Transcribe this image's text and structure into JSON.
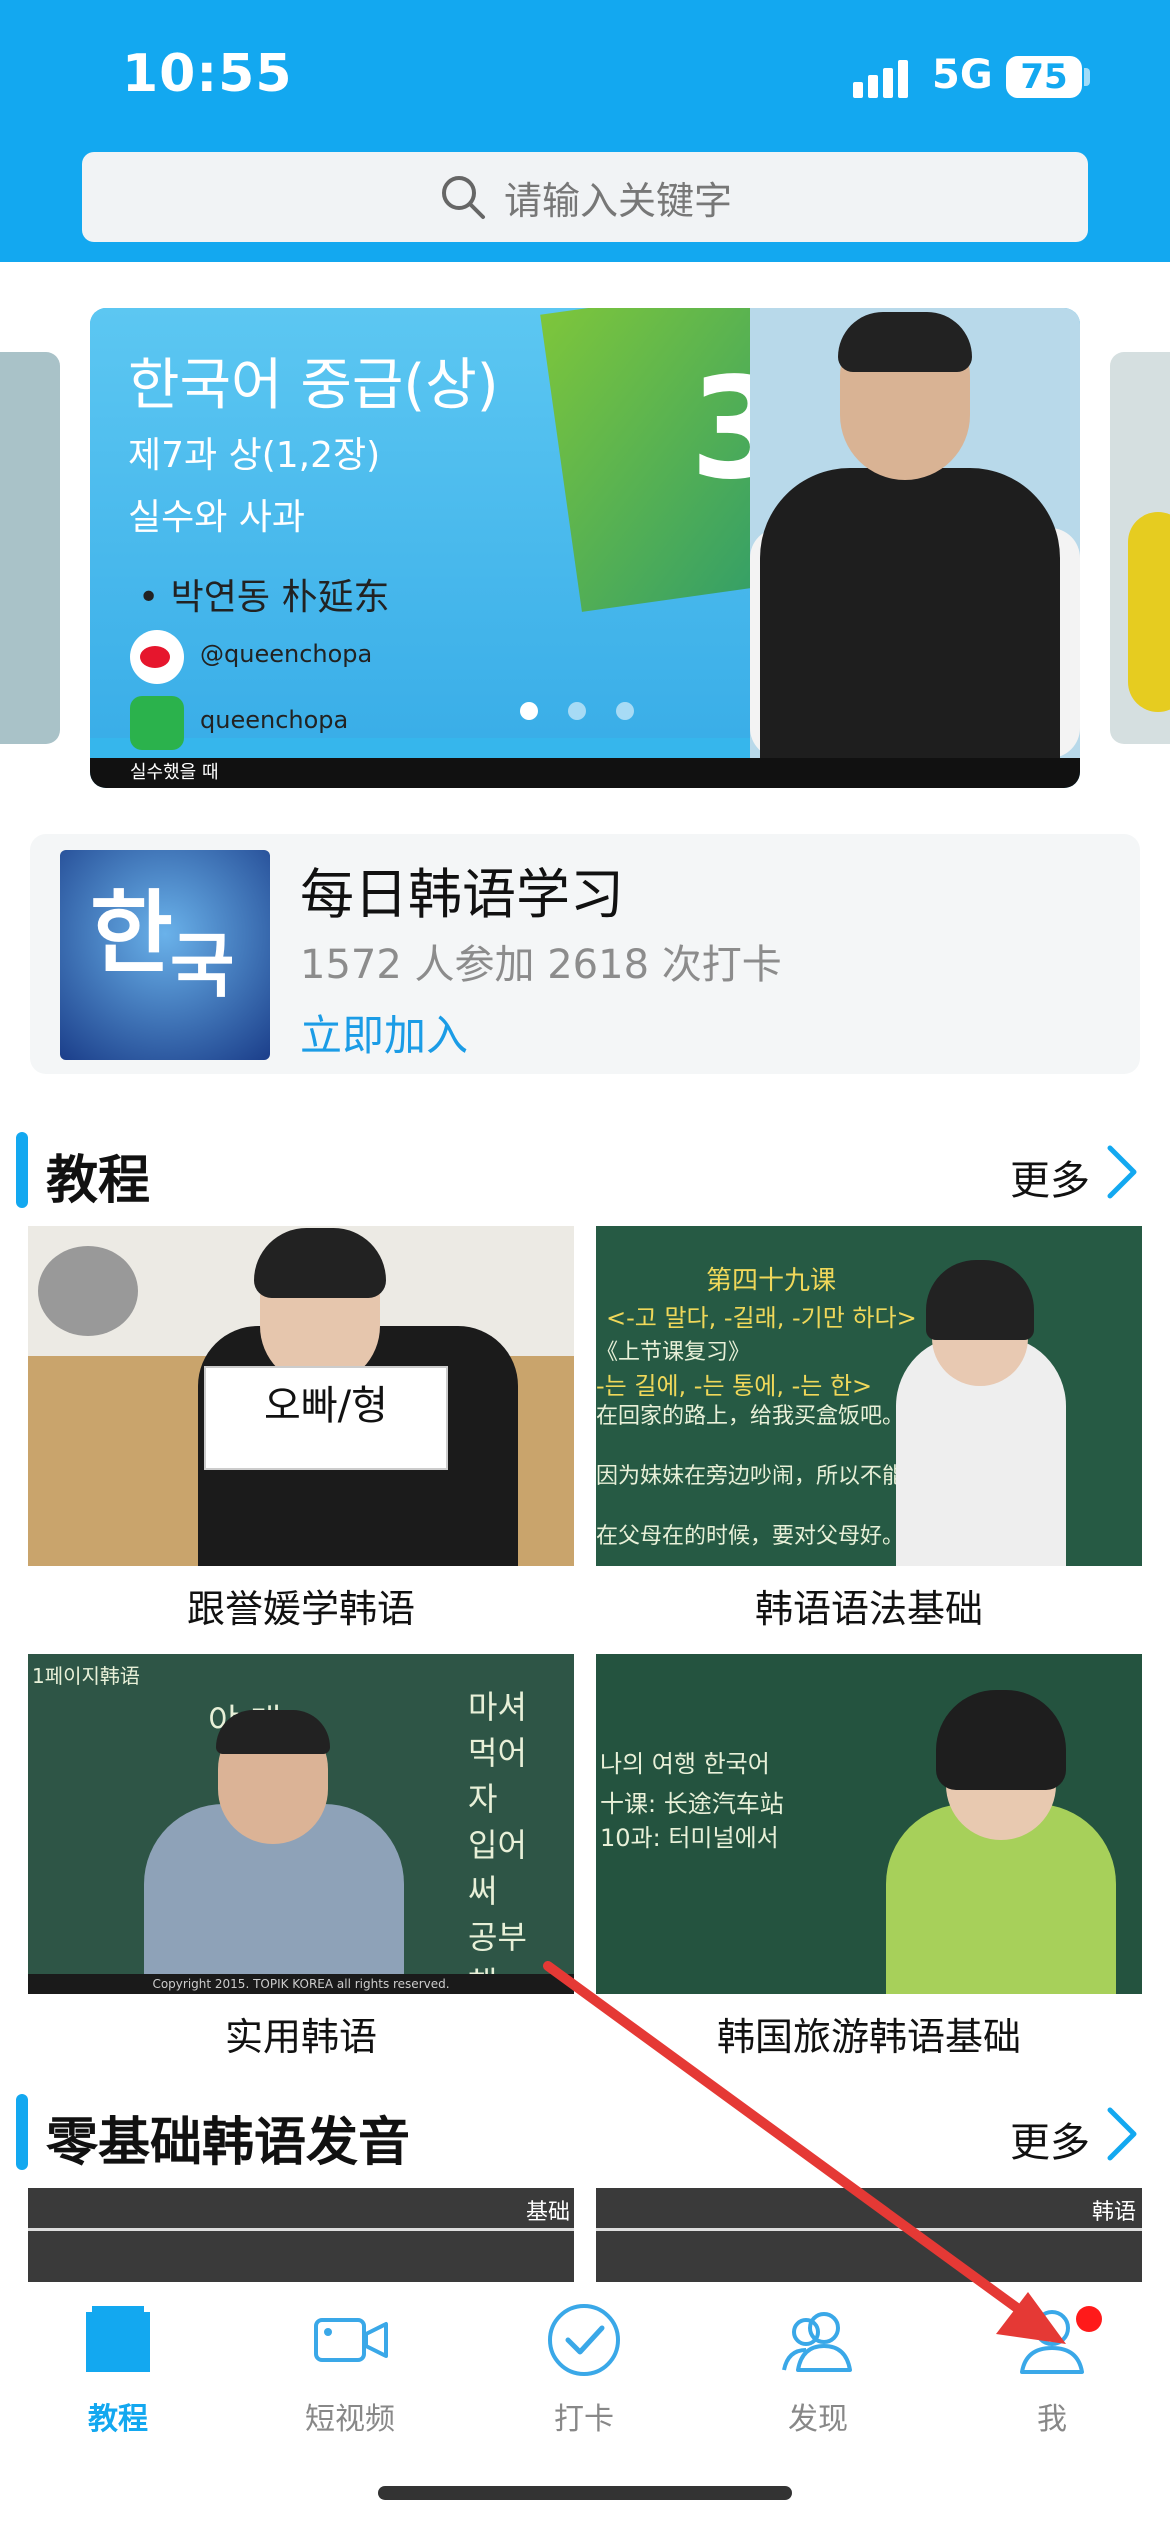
{
  "status": {
    "time": "10:55",
    "network": "5G",
    "battery": "75"
  },
  "search": {
    "placeholder": "请输入关键字",
    "icon": "search-icon"
  },
  "banner": {
    "title": "한국어 중급(상)",
    "line1": "제7과 상(1,2장)",
    "line2": "실수와 사과",
    "teacher": "• 박연동  朴延东",
    "weibo_handle": "@queenchopa",
    "wechat_handle": "queenchopa",
    "subtitle": "실수했을 때",
    "dots": 3,
    "active_dot": 0
  },
  "group": {
    "title": "每日韩语学习",
    "stats": "1572 人参加 2618 次打卡",
    "join": "立即加入"
  },
  "sections": [
    {
      "title": "教程",
      "more": "更多",
      "items": [
        {
          "label": "跟誉媛学韩语"
        },
        {
          "label": "韩语语法基础"
        },
        {
          "label": "实用韩语"
        },
        {
          "label": "韩国旅游韩语基础"
        }
      ]
    },
    {
      "title": "零基础韩语发音",
      "more": "更多"
    }
  ],
  "tiles": {
    "t1_card": "오빠/형",
    "t2_head": "第四十九课",
    "t2_l1": "<-고 말다, -길래, -기만 하다>",
    "t2_l2": "《上节课复习》",
    "t2_l3": "-는 길에, -는 통에, -는 한>",
    "t2_l4": "在回家的路上，给我买盒饭吧。",
    "t2_l5": "因为妹妹在旁边吵闹，所以不能集中。",
    "t2_l6": "在父母在的时候，要对父母好。",
    "t3_head": "1페이지韩语",
    "t3_chalk1": "야 대",
    "t3_chalk2": "마셔 먹어 자 입어 써 공부해",
    "t3_copy": "Copyright 2015. TOPIK KOREA all rights reserved.",
    "t4_l1": "나의 여행 한국어",
    "t4_l2": "十课: 长途汽车站",
    "t4_l3": "10과: 터미널에서",
    "t5_tag": "基础",
    "t6_tag": "韩语"
  },
  "nav": [
    {
      "label": "教程",
      "icon": "book-icon",
      "active": true
    },
    {
      "label": "短视频",
      "icon": "video-camera-icon",
      "active": false
    },
    {
      "label": "打卡",
      "icon": "check-circle-icon",
      "active": false
    },
    {
      "label": "发现",
      "icon": "people-icon",
      "active": false
    },
    {
      "label": "我",
      "icon": "person-icon",
      "active": false
    }
  ],
  "colors": {
    "accent": "#13a8f0",
    "badge": "#ff1a1a",
    "annotation_arrow": "#e53935"
  }
}
